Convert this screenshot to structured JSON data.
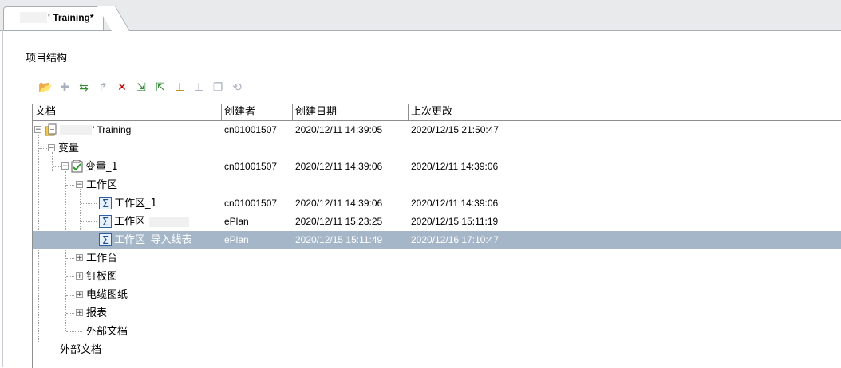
{
  "tab": {
    "label": "' Training*"
  },
  "section": {
    "title": "项目结构"
  },
  "toolbar": [
    {
      "name": "open-folder-icon",
      "glyph": "📂"
    },
    {
      "name": "add-icon",
      "glyph": "✚"
    },
    {
      "name": "transfer-icon",
      "glyph": "⇆"
    },
    {
      "name": "forward-icon",
      "glyph": "↱"
    },
    {
      "name": "delete-icon",
      "glyph": "✕"
    },
    {
      "name": "import-icon",
      "glyph": "⇲"
    },
    {
      "name": "export-icon",
      "glyph": "⇱"
    },
    {
      "name": "stamp-icon",
      "glyph": "⊥"
    },
    {
      "name": "stamp-disabled-icon",
      "glyph": "⊥"
    },
    {
      "name": "document-icon",
      "glyph": "❐"
    },
    {
      "name": "refresh-icon",
      "glyph": "⟲"
    }
  ],
  "columns": {
    "doc": "文档",
    "creator": "创建者",
    "created": "创建日期",
    "modified": "上次更改"
  },
  "rows": [
    {
      "name": "' Training",
      "creator": "cn01001507",
      "created": "2020/12/11 14:39:05",
      "modified": "2020/12/15 21:50:47"
    },
    {
      "name": "变量",
      "creator": "",
      "created": "",
      "modified": ""
    },
    {
      "name": "变量_1",
      "creator": "cn01001507",
      "created": "2020/12/11 14:39:06",
      "modified": "2020/12/11 14:39:06"
    },
    {
      "name": "工作区",
      "creator": "",
      "created": "",
      "modified": ""
    },
    {
      "name": "工作区_1",
      "creator": "cn01001507",
      "created": "2020/12/11 14:39:06",
      "modified": "2020/12/11 14:39:06"
    },
    {
      "name": "工作区",
      "creator": "ePlan",
      "created": "2020/12/11 15:23:25",
      "modified": "2020/12/15 15:11:19"
    },
    {
      "name": "工作区_导入线表",
      "creator": "ePlan",
      "created": "2020/12/15 15:11:49",
      "modified": "2020/12/16 17:10:47"
    },
    {
      "name": "工作台",
      "creator": "",
      "created": "",
      "modified": ""
    },
    {
      "name": "钉板图",
      "creator": "",
      "created": "",
      "modified": ""
    },
    {
      "name": "电缆图纸",
      "creator": "",
      "created": "",
      "modified": ""
    },
    {
      "name": "报表",
      "creator": "",
      "created": "",
      "modified": ""
    },
    {
      "name": "外部文档",
      "creator": "",
      "created": "",
      "modified": ""
    },
    {
      "name": "外部文档",
      "creator": "",
      "created": "",
      "modified": ""
    }
  ],
  "colors": {
    "selection": "#a5b6c9",
    "border": "#8e8e8e"
  }
}
